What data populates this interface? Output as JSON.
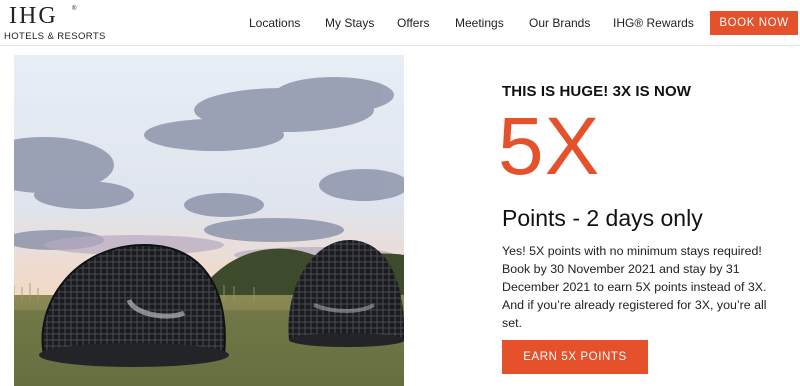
{
  "brand": {
    "logo_main": "IHG",
    "logo_reg": "®",
    "logo_sub": "HOTELS & RESORTS"
  },
  "nav": {
    "items": [
      "Locations",
      "My Stays",
      "Offers",
      "Meetings",
      "Our Brands",
      "IHG® Rewards"
    ],
    "book_label": "BOOK NOW"
  },
  "colors": {
    "accent": "#e5512b",
    "text": "#111111"
  },
  "promo": {
    "kicker": "THIS IS HUGE! 3X IS NOW",
    "big": "5X",
    "sub": "Points - 2 days only",
    "body": "Yes! 5X points with no minimum stays required! Book by 30 November 2021 and stay by 31 December 2021 to earn 5X points instead of 3X. And if you’re already registered for 3X, you’re all set.",
    "cta_label": "EARN 5X POINTS"
  }
}
